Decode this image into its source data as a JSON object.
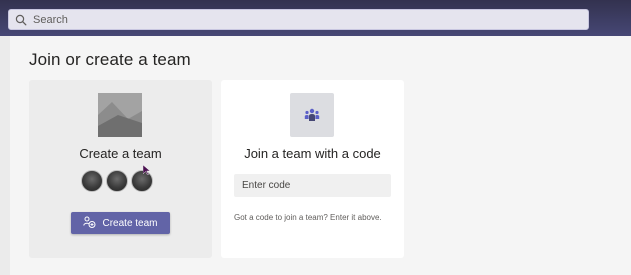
{
  "search": {
    "placeholder": "Search"
  },
  "page": {
    "title": "Join or create a team"
  },
  "create_card": {
    "title": "Create a team",
    "button_label": "Create team"
  },
  "join_card": {
    "title": "Join a team with a code",
    "code_placeholder": "Enter code",
    "hint": "Got a code to join a team? Enter it above."
  },
  "colors": {
    "topbar": "#464775",
    "accent": "#6264a7",
    "page_bg": "#f5f5f5",
    "create_card_bg": "#ececec",
    "join_card_bg": "#ffffff"
  },
  "icons": {
    "search": "search-icon",
    "team_image": "team-picture-icon",
    "join": "team-people-icon",
    "create_button": "team-add-icon"
  }
}
